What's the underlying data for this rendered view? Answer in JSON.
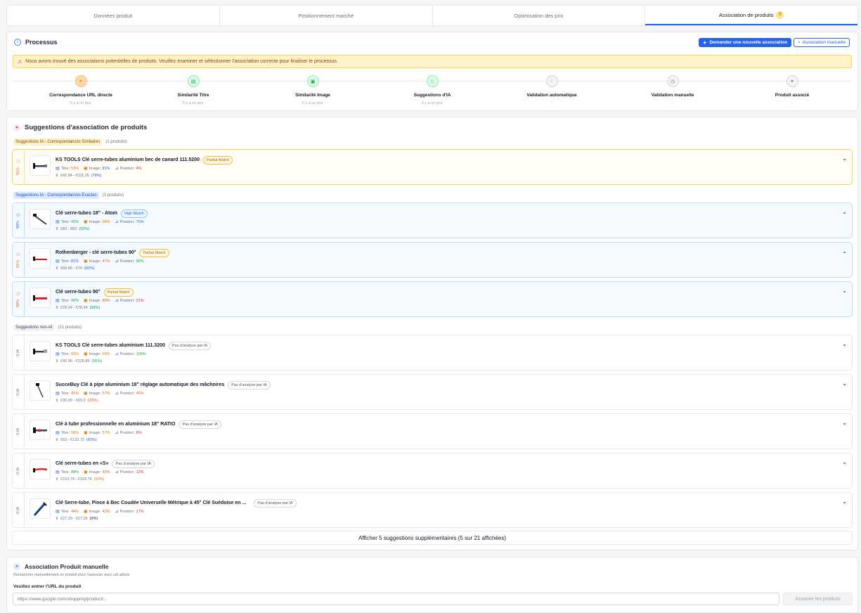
{
  "tabs": [
    {
      "label": "Données produit"
    },
    {
      "label": "Positionnement marché"
    },
    {
      "label": "Optimisation des prix"
    },
    {
      "label": "Association de produits",
      "badge": "⏱"
    }
  ],
  "process": {
    "title": "Processus",
    "btn_new": "Demander une nouvelle association",
    "btn_manual": "Association manuelle",
    "alert": "Nous avons trouvé des associations potentielles de produits. Veuillez examiner et sélectionner l'association correcte pour finaliser le processus.",
    "steps": [
      {
        "label": "Correspondance URL directe",
        "sub": "Il y a un jour"
      },
      {
        "label": "Similarité Titre",
        "sub": "Il y a un jour"
      },
      {
        "label": "Similarité Image",
        "sub": "Il y a un jour"
      },
      {
        "label": "Suggestions d'IA",
        "sub": "Il y a un jour"
      },
      {
        "label": "Validation automatique",
        "sub": "-"
      },
      {
        "label": "Validation manuelle",
        "sub": "-"
      },
      {
        "label": "Produit associé",
        "sub": "-"
      }
    ]
  },
  "suggestions": {
    "title": "Suggestions d'association de produits",
    "groups": [
      {
        "tag": "Suggestions IA - Correspondances Similaires",
        "count": "(1 produits)"
      },
      {
        "tag": "Suggestions IA - Correspondances Exactes",
        "count": "(3 produits)"
      },
      {
        "tag": "Suggestions non-AI",
        "count": "(21 produits)"
      }
    ],
    "labels": {
      "titre": "Titre:",
      "image": "Image:",
      "position": "Position:"
    },
    "items": [
      {
        "score": "81%",
        "name": "KS TOOLS Clé serre-tubes aluminium bec de canard 111.5200",
        "badge": "Partial Match",
        "titre": "53%",
        "image": "81%",
        "position": "4%",
        "price": "€42.84 - €111.25",
        "pct": "(78%)"
      },
      {
        "score": "90%",
        "name": "Clé serre-tubes 18\" - Atom",
        "badge": "High Match",
        "titre": "90%",
        "image": "58%",
        "position": "75%",
        "price": "€83 - €83",
        "pct": "(92%)"
      },
      {
        "score": "81%",
        "name": "Rothenberger - clé serre-tubes 90°",
        "badge": "Partial Match",
        "titre": "81%",
        "image": "47%",
        "position": "96%",
        "price": "€60.86 - €70",
        "pct": "(82%)"
      },
      {
        "score": "80%",
        "name": "Clé serre-tubes 90°",
        "badge": "Partial Match",
        "titre": "90%",
        "image": "49%",
        "position": "21%",
        "price": "€78.34 - €78.34",
        "pct": "(98%)"
      },
      {
        "score": "0 IA",
        "name": "KS TOOLS Clé serre-tubes aluminium 111.3200",
        "badge": "Pas d'analyse par IA",
        "titre": "83%",
        "image": "59%",
        "position": "100%",
        "price": "€42.96 - €126.86",
        "pct": "(95%)"
      },
      {
        "score": "0 IA",
        "name": "SucceBuy Clé à pipe aluminium 18\" réglage automatique des mâchoires",
        "badge": "Pas d'analyse par IA",
        "titre": "41%",
        "image": "57%",
        "position": "46%",
        "price": "€35.99 - €69.3",
        "pct": "(33%)"
      },
      {
        "score": "0 IA",
        "name": "Clé à tube professionnelle en aluminium 18\" RATIO",
        "badge": "Pas d'analyse par IA",
        "titre": "58%",
        "image": "57%",
        "position": "8%",
        "price": "€53 - €132.72",
        "pct": "(83%)"
      },
      {
        "score": "0 IA",
        "name": "Clé serre-tubes en «S»",
        "badge": "Pas d'analyse par IA",
        "titre": "88%",
        "image": "45%",
        "position": "13%",
        "price": "€153.74 - €153.74",
        "pct": "(50%)"
      },
      {
        "score": "0 IA",
        "name": "Clé Serre-tube, Pince à Bec Coudée Universelle Métrique à 45° Clé Suédoise en ...",
        "badge": "Pas d'analyse par IA",
        "titre": "44%",
        "image": "43%",
        "position": "17%",
        "price": "€27.29 - €27.29",
        "pct": "(0%)"
      }
    ],
    "more": "Afficher 5 suggestions supplémentaires (5 sur 21 affichées)"
  },
  "manual": {
    "title": "Association Produit manuelle",
    "subtitle": "Rechercher manuellement un produit pour l'associer avec cet article",
    "label": "Veuillez entrer l'URL du produit",
    "placeholder": "https://www.google.com/shopping/product/...",
    "button": "Associer les produits"
  }
}
